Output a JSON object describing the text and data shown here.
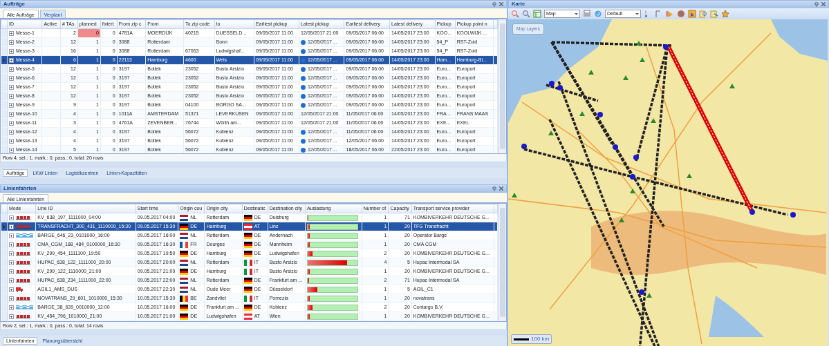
{
  "orders_panel": {
    "title": "Aufträge",
    "tabs": [
      {
        "label": "Alle Aufträge",
        "selected": true
      },
      {
        "label": "Verplant",
        "selected": false
      }
    ],
    "columns": [
      "ID",
      "Active",
      "# TAs",
      "planned",
      "fixiert",
      "From zip c",
      "From",
      "To zip code",
      "to",
      "Earliest pickup",
      "Latest pickup",
      "Earliest delivery",
      "Latest delivery",
      "Pickup",
      "Pickup point n"
    ],
    "rows": [
      {
        "selected": false,
        "planned_alert": true,
        "cells": [
          "Messe-1",
          "",
          "2",
          "0",
          "0",
          "4781A",
          "MOERDIJK",
          "40215",
          "DUESSELD...",
          "09/05/2017 11:00",
          "12/05/2017 21:00",
          "09/05/2017 06:00",
          "14/05/2017 23:00",
          "KOO...",
          "KOOLWIJK ..."
        ],
        "info": false
      },
      {
        "selected": false,
        "planned_alert": false,
        "cells": [
          "Messe-2",
          "",
          "12",
          "1",
          "0",
          "3088",
          "Rotterdam",
          "",
          "Bonn",
          "09/05/2017 11:00",
          "12/05/2017 ...",
          "09/05/2017 06:00",
          "14/05/2017 23:00",
          "54_P",
          "RST-Zuid"
        ],
        "info": true
      },
      {
        "selected": false,
        "planned_alert": false,
        "cells": [
          "Messe-3",
          "",
          "16",
          "1",
          "0",
          "3088",
          "Rotterdam",
          "67063",
          "Ludwigshaf...",
          "09/05/2017 11:00",
          "12/05/2017 ...",
          "09/05/2017 06:00",
          "14/05/2017 23:00",
          "54_P",
          "RST-Zuid"
        ],
        "info": true
      },
      {
        "selected": true,
        "planned_alert": false,
        "cells": [
          "Messe-4",
          "",
          "6",
          "1",
          "0",
          "22113",
          "Hamburg",
          "4600",
          "Wels",
          "09/05/2017 11:00",
          "12/05/2017 ...",
          "09/05/2017 06:00",
          "14/05/2017 23:00",
          "Ham...",
          "Hamburg-Bi..."
        ],
        "info": true
      },
      {
        "selected": false,
        "planned_alert": false,
        "cells": [
          "Messe-5",
          "",
          "12",
          "1",
          "0",
          "3197",
          "Botlek",
          "23052",
          "Busto Arsizio",
          "09/05/2017 11:00",
          "12/05/2017 ...",
          "09/05/2017 06:00",
          "14/05/2017 23:00",
          "Euro...",
          "Europort"
        ],
        "info": true
      },
      {
        "selected": false,
        "planned_alert": false,
        "cells": [
          "Messe-6",
          "",
          "12",
          "1",
          "0",
          "3197",
          "Botlek",
          "23052",
          "Busto Arsizio",
          "09/05/2017 11:00",
          "12/05/2017 ...",
          "09/05/2017 06:00",
          "14/05/2017 23:00",
          "Euro...",
          "Europort"
        ],
        "info": true
      },
      {
        "selected": false,
        "planned_alert": false,
        "cells": [
          "Messe-7",
          "",
          "12",
          "1",
          "0",
          "3197",
          "Botlek",
          "23052",
          "Busto Arsizio",
          "09/05/2017 11:00",
          "12/05/2017 ...",
          "09/05/2017 06:00",
          "14/05/2017 23:00",
          "Euro...",
          "Europort"
        ],
        "info": true
      },
      {
        "selected": false,
        "planned_alert": false,
        "cells": [
          "Messe-8",
          "",
          "12",
          "1",
          "0",
          "3197",
          "Botlek",
          "23052",
          "Busto Arsizio",
          "09/05/2017 11:00",
          "12/05/2017 ...",
          "09/05/2017 06:00",
          "14/05/2017 23:00",
          "Euro...",
          "Europort"
        ],
        "info": true
      },
      {
        "selected": false,
        "planned_alert": false,
        "cells": [
          "Messe-9",
          "",
          "9",
          "1",
          "0",
          "3197",
          "Botlek",
          "04100",
          "BORGO SA...",
          "09/05/2017 11:00",
          "12/05/2017 ...",
          "09/05/2017 06:00",
          "14/05/2017 23:00",
          "Euro...",
          "Europort"
        ],
        "info": true
      },
      {
        "selected": false,
        "planned_alert": false,
        "cells": [
          "Messe-10",
          "",
          "4",
          "1",
          "0",
          "1011A",
          "AMSTERDAM",
          "51371",
          "LEVERKUSEN",
          "09/05/2017 11:00",
          "12/05/2017 21:00",
          "11/05/2017 06:00",
          "14/05/2017 23:00",
          "FRA...",
          "FRANS MAAS"
        ],
        "info": false
      },
      {
        "selected": false,
        "planned_alert": false,
        "cells": [
          "Messe-11",
          "",
          "3",
          "1",
          "0",
          "4761A",
          "ZEVENBER...",
          "76744",
          "Wörth am...",
          "09/05/2017 11:00",
          "12/05/2017 21:00",
          "11/05/2017 06:00",
          "14/05/2017 23:00",
          "EXE...",
          "EXEL"
        ],
        "info": false
      },
      {
        "selected": false,
        "planned_alert": false,
        "cells": [
          "Messe-12",
          "",
          "4",
          "1",
          "0",
          "3197",
          "Botlek",
          "56072",
          "Koblenz",
          "09/05/2017 11:00",
          "12/05/2017 ...",
          "11/05/2017 06:00",
          "14/05/2017 23:00",
          "Euro...",
          "Europort"
        ],
        "info": true
      },
      {
        "selected": false,
        "planned_alert": false,
        "cells": [
          "Messe-13",
          "",
          "4",
          "1",
          "0",
          "3197",
          "Botlek",
          "56072",
          "Koblenz",
          "09/05/2017 11:00",
          "12/05/2017 ...",
          "12/05/2017 06:00",
          "14/05/2017 23:00",
          "Euro...",
          "Europort"
        ],
        "info": true
      },
      {
        "selected": false,
        "planned_alert": false,
        "cells": [
          "Messe-14",
          "",
          "5",
          "1",
          "0",
          "3197",
          "Botlek",
          "56072",
          "Koblenz",
          "09/05/2017 11:00",
          "12/05/2017 ...",
          "18/05/2017 06:00",
          "22/05/2017 23:00",
          "Euro...",
          "Europort"
        ],
        "info": true
      }
    ],
    "status": "Row 4, sel.: 1, mark.: 0, pass.: 0, total: 20 rows"
  },
  "orders_bottom_tabs": [
    {
      "label": "Aufträge",
      "selected": true
    },
    {
      "label": "LKW Linien",
      "selected": false
    },
    {
      "label": "Logistikzentren",
      "selected": false
    },
    {
      "label": "Linien-Kapazitäten",
      "selected": false
    }
  ],
  "lines_panel": {
    "title": "Linienfahrten",
    "tabs": [
      {
        "label": "Alle Linienfahrten",
        "selected": true
      }
    ],
    "columns": [
      "Mode",
      "Line ID",
      "Start time",
      "Origin cou",
      "Origin city",
      "Destinatic",
      "Destination city",
      "Auslastung",
      "Number of",
      "Capacity",
      "Transport service provider"
    ],
    "rows": [
      {
        "kind": "rail",
        "selected": false,
        "line_id": "KV_638_197_1111000_04:00",
        "start": "09.05.2017 04:00",
        "origin_flag": {
          "kind": "horizontal",
          "stripes": [
            {
              "color": "#ae1c28"
            },
            {
              "color": "#ffffff"
            },
            {
              "color": "#21468b"
            }
          ]
        },
        "origin": "NL",
        "origin_city": "Rotterdam",
        "dest_flag": {
          "kind": "horizontal",
          "stripes": [
            {
              "color": "#000000"
            },
            {
              "color": "#dd0000"
            },
            {
              "color": "#ffce00"
            }
          ]
        },
        "dest": "DE",
        "dest_city": "Duisburg",
        "level": 0.02,
        "number": "1",
        "capacity": "71",
        "provider": "KOMBIVERKEHR DEUTSCHE G..."
      },
      {
        "kind": "rail",
        "selected": true,
        "line_id": "TRANSFRACHT_300_431_1110000_15:30",
        "start": "09.05.2017 15:30",
        "origin_flag": {
          "kind": "horizontal",
          "stripes": [
            {
              "color": "#000000"
            },
            {
              "color": "#dd0000"
            },
            {
              "color": "#ffce00"
            }
          ]
        },
        "origin": "DE",
        "origin_city": "Hamburg",
        "dest_flag": {
          "kind": "horizontal",
          "stripes": [
            {
              "color": "#ed2939"
            },
            {
              "color": "#ffffff"
            },
            {
              "color": "#ed2939"
            }
          ]
        },
        "dest": "AT",
        "dest_city": "Linz",
        "level": 0.05,
        "number": "1",
        "capacity": "20",
        "provider": "TFG Transfracht"
      },
      {
        "kind": "barge",
        "selected": false,
        "line_id": "BARGE_646_23_0101000_16:00",
        "start": "09.05.2017 16:00",
        "origin_flag": {
          "kind": "horizontal",
          "stripes": [
            {
              "color": "#ae1c28"
            },
            {
              "color": "#ffffff"
            },
            {
              "color": "#21468b"
            }
          ]
        },
        "origin": "NL",
        "origin_city": "Rotterdam",
        "dest_flag": {
          "kind": "horizontal",
          "stripes": [
            {
              "color": "#000000"
            },
            {
              "color": "#dd0000"
            },
            {
              "color": "#ffce00"
            }
          ]
        },
        "dest": "DE",
        "dest_city": "Andernach",
        "level": 0.05,
        "number": "1",
        "capacity": "20",
        "provider": "Operator Barge"
      },
      {
        "kind": "rail",
        "selected": false,
        "line_id": "CMA_CGM_188_484_0100000_16:30",
        "start": "09.05.2017 16:30",
        "origin_flag": {
          "kind": "vertical",
          "stripes": [
            {
              "color": "#0055a4"
            },
            {
              "color": "#ffffff"
            },
            {
              "color": "#ef4135"
            }
          ]
        },
        "origin": "FR",
        "origin_city": "Dourges",
        "dest_flag": {
          "kind": "horizontal",
          "stripes": [
            {
              "color": "#000000"
            },
            {
              "color": "#dd0000"
            },
            {
              "color": "#ffce00"
            }
          ]
        },
        "dest": "DE",
        "dest_city": "Mannheim",
        "level": 0.05,
        "number": "1",
        "capacity": "20",
        "provider": "CMA CGM"
      },
      {
        "kind": "rail",
        "selected": false,
        "line_id": "KV_299_454_1111100_19:50",
        "start": "09.05.2017 19:50",
        "origin_flag": {
          "kind": "horizontal",
          "stripes": [
            {
              "color": "#000000"
            },
            {
              "color": "#dd0000"
            },
            {
              "color": "#ffce00"
            }
          ]
        },
        "origin": "DE",
        "origin_city": "Hamburg",
        "dest_flag": {
          "kind": "horizontal",
          "stripes": [
            {
              "color": "#000000"
            },
            {
              "color": "#dd0000"
            },
            {
              "color": "#ffce00"
            }
          ]
        },
        "dest": "DE",
        "dest_city": "Ludwigshafen",
        "level": 0.1,
        "number": "2",
        "capacity": "20",
        "provider": "KOMBIVERKEHR DEUTSCHE G..."
      },
      {
        "kind": "rail",
        "selected": false,
        "line_id": "HUPAC_638_122_1111000_20:00",
        "start": "09.05.2017 20:00",
        "origin_flag": {
          "kind": "horizontal",
          "stripes": [
            {
              "color": "#ae1c28"
            },
            {
              "color": "#ffffff"
            },
            {
              "color": "#21468b"
            }
          ]
        },
        "origin": "NL",
        "origin_city": "Rotterdam",
        "dest_flag": {
          "kind": "vertical",
          "stripes": [
            {
              "color": "#009246"
            },
            {
              "color": "#ffffff"
            },
            {
              "color": "#ce2b37"
            }
          ]
        },
        "dest": "IT",
        "dest_city": "Busto Arsizio",
        "level": 0.8,
        "number": "4",
        "capacity": "5",
        "provider": "Hupac Intermodal SA"
      },
      {
        "kind": "rail",
        "selected": false,
        "line_id": "KV_299_122_1110000_21:00",
        "start": "09.05.2017 21:00",
        "origin_flag": {
          "kind": "horizontal",
          "stripes": [
            {
              "color": "#000000"
            },
            {
              "color": "#dd0000"
            },
            {
              "color": "#ffce00"
            }
          ]
        },
        "origin": "DE",
        "origin_city": "Hamburg",
        "dest_flag": {
          "kind": "vertical",
          "stripes": [
            {
              "color": "#009246"
            },
            {
              "color": "#ffffff"
            },
            {
              "color": "#ce2b37"
            }
          ]
        },
        "dest": "IT",
        "dest_city": "Busto Arsizio",
        "level": 0.05,
        "number": "1",
        "capacity": "20",
        "provider": "KOMBIVERKEHR DEUTSCHE G..."
      },
      {
        "kind": "rail",
        "selected": false,
        "line_id": "HUPAC_638_234_1111000_22:00",
        "start": "09.05.2017 22:00",
        "origin_flag": {
          "kind": "horizontal",
          "stripes": [
            {
              "color": "#ae1c28"
            },
            {
              "color": "#ffffff"
            },
            {
              "color": "#21468b"
            }
          ]
        },
        "origin": "NL",
        "origin_city": "Rotterdam",
        "dest_flag": {
          "kind": "horizontal",
          "stripes": [
            {
              "color": "#000000"
            },
            {
              "color": "#dd0000"
            },
            {
              "color": "#ffce00"
            }
          ]
        },
        "dest": "DE",
        "dest_city": "Frankfurt am ...",
        "level": 0.03,
        "number": "2",
        "capacity": "71",
        "provider": "Hupac Intermodal SA"
      },
      {
        "kind": "truck",
        "selected": false,
        "line_id": "AGIL1_AMS_DUS",
        "start": "09.05.2017 22:30",
        "origin_flag": {
          "kind": "horizontal",
          "stripes": [
            {
              "color": "#ae1c28"
            },
            {
              "color": "#ffffff"
            },
            {
              "color": "#21468b"
            }
          ]
        },
        "origin": "NL",
        "origin_city": "Oude Meer",
        "dest_flag": {
          "kind": "horizontal",
          "stripes": [
            {
              "color": "#000000"
            },
            {
              "color": "#dd0000"
            },
            {
              "color": "#ffce00"
            }
          ]
        },
        "dest": "DE",
        "dest_city": "Düsseldorf",
        "level": 0.2,
        "number": "1",
        "capacity": "5",
        "provider": "AGIL_C1"
      },
      {
        "kind": "rail",
        "selected": false,
        "line_id": "NOVATRANS_29_601_1010000_15:30",
        "start": "10.05.2017 15:30",
        "origin_flag": {
          "kind": "vertical",
          "stripes": [
            {
              "color": "#000000"
            },
            {
              "color": "#fdda24"
            },
            {
              "color": "#ef3340"
            }
          ]
        },
        "origin": "BE",
        "origin_city": "Zandvliet",
        "dest_flag": {
          "kind": "vertical",
          "stripes": [
            {
              "color": "#009246"
            },
            {
              "color": "#ffffff"
            },
            {
              "color": "#ce2b37"
            }
          ]
        },
        "dest": "IT",
        "dest_city": "Pomezia",
        "level": 0.05,
        "number": "1",
        "capacity": "20",
        "provider": "novatrans"
      },
      {
        "kind": "barge",
        "selected": false,
        "line_id": "BARGE_38_639_0010000_12:00",
        "start": "10.05.2017 16:00",
        "origin_flag": {
          "kind": "horizontal",
          "stripes": [
            {
              "color": "#000000"
            },
            {
              "color": "#dd0000"
            },
            {
              "color": "#ffce00"
            }
          ]
        },
        "origin": "DE",
        "origin_city": "Frankfurt am ...",
        "dest_flag": {
          "kind": "horizontal",
          "stripes": [
            {
              "color": "#000000"
            },
            {
              "color": "#dd0000"
            },
            {
              "color": "#ffce00"
            }
          ]
        },
        "dest": "DE",
        "dest_city": "Koblenz",
        "level": 0.1,
        "number": "2",
        "capacity": "20",
        "provider": "Contargo B.V."
      },
      {
        "kind": "rail",
        "selected": false,
        "line_id": "KV_454_796_1010000_21:00",
        "start": "10.05.2017 21:00",
        "origin_flag": {
          "kind": "horizontal",
          "stripes": [
            {
              "color": "#000000"
            },
            {
              "color": "#dd0000"
            },
            {
              "color": "#ffce00"
            }
          ]
        },
        "origin": "DE",
        "origin_city": "Ludwigshafen",
        "dest_flag": {
          "kind": "horizontal",
          "stripes": [
            {
              "color": "#ed2939"
            },
            {
              "color": "#ffffff"
            },
            {
              "color": "#ed2939"
            }
          ]
        },
        "dest": "AT",
        "dest_city": "Wien",
        "level": 0.05,
        "number": "1",
        "capacity": "20",
        "provider": "KOMBIVERKEHR DEUTSCHE G..."
      }
    ],
    "status": "Row 2, sel.: 1, mark.: 0, pass.: 0, total: 14 rows"
  },
  "lines_bottom_tabs": [
    {
      "label": "Linienfahrten",
      "selected": true
    },
    {
      "label": "Planungsübersicht",
      "selected": false
    }
  ],
  "map_panel": {
    "title": "Karte",
    "view_select": "Map",
    "style_select": "Default",
    "layers_button": "Map Layers",
    "scale": "100 km"
  }
}
